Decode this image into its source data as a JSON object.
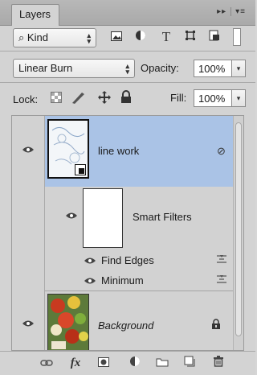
{
  "tab": {
    "label": "Layers"
  },
  "header_icons": {
    "expand": "double-arrow-icon",
    "menu": "panel-menu-icon"
  },
  "filter": {
    "kind_label": "Kind",
    "icons": [
      "pixel-filter-icon",
      "adjustment-filter-icon",
      "type-filter-icon",
      "shape-filter-icon",
      "smart-object-filter-icon"
    ],
    "type_glyph": "T"
  },
  "blend": {
    "mode": "Linear Burn",
    "opacity_label": "Opacity:",
    "opacity_value": "100%"
  },
  "lock": {
    "label": "Lock:",
    "fill_label": "Fill:",
    "fill_value": "100%"
  },
  "layers": [
    {
      "name": "line work",
      "selected": true
    },
    {
      "name": "Smart Filters"
    },
    {
      "name": "Find Edges"
    },
    {
      "name": "Minimum"
    },
    {
      "name": "Background",
      "locked": true
    }
  ],
  "footer_icons": [
    "link-icon",
    "fx-icon",
    "mask-icon",
    "adjustment-icon",
    "folder-icon",
    "new-layer-icon",
    "trash-icon"
  ],
  "footer_fx": "fx"
}
